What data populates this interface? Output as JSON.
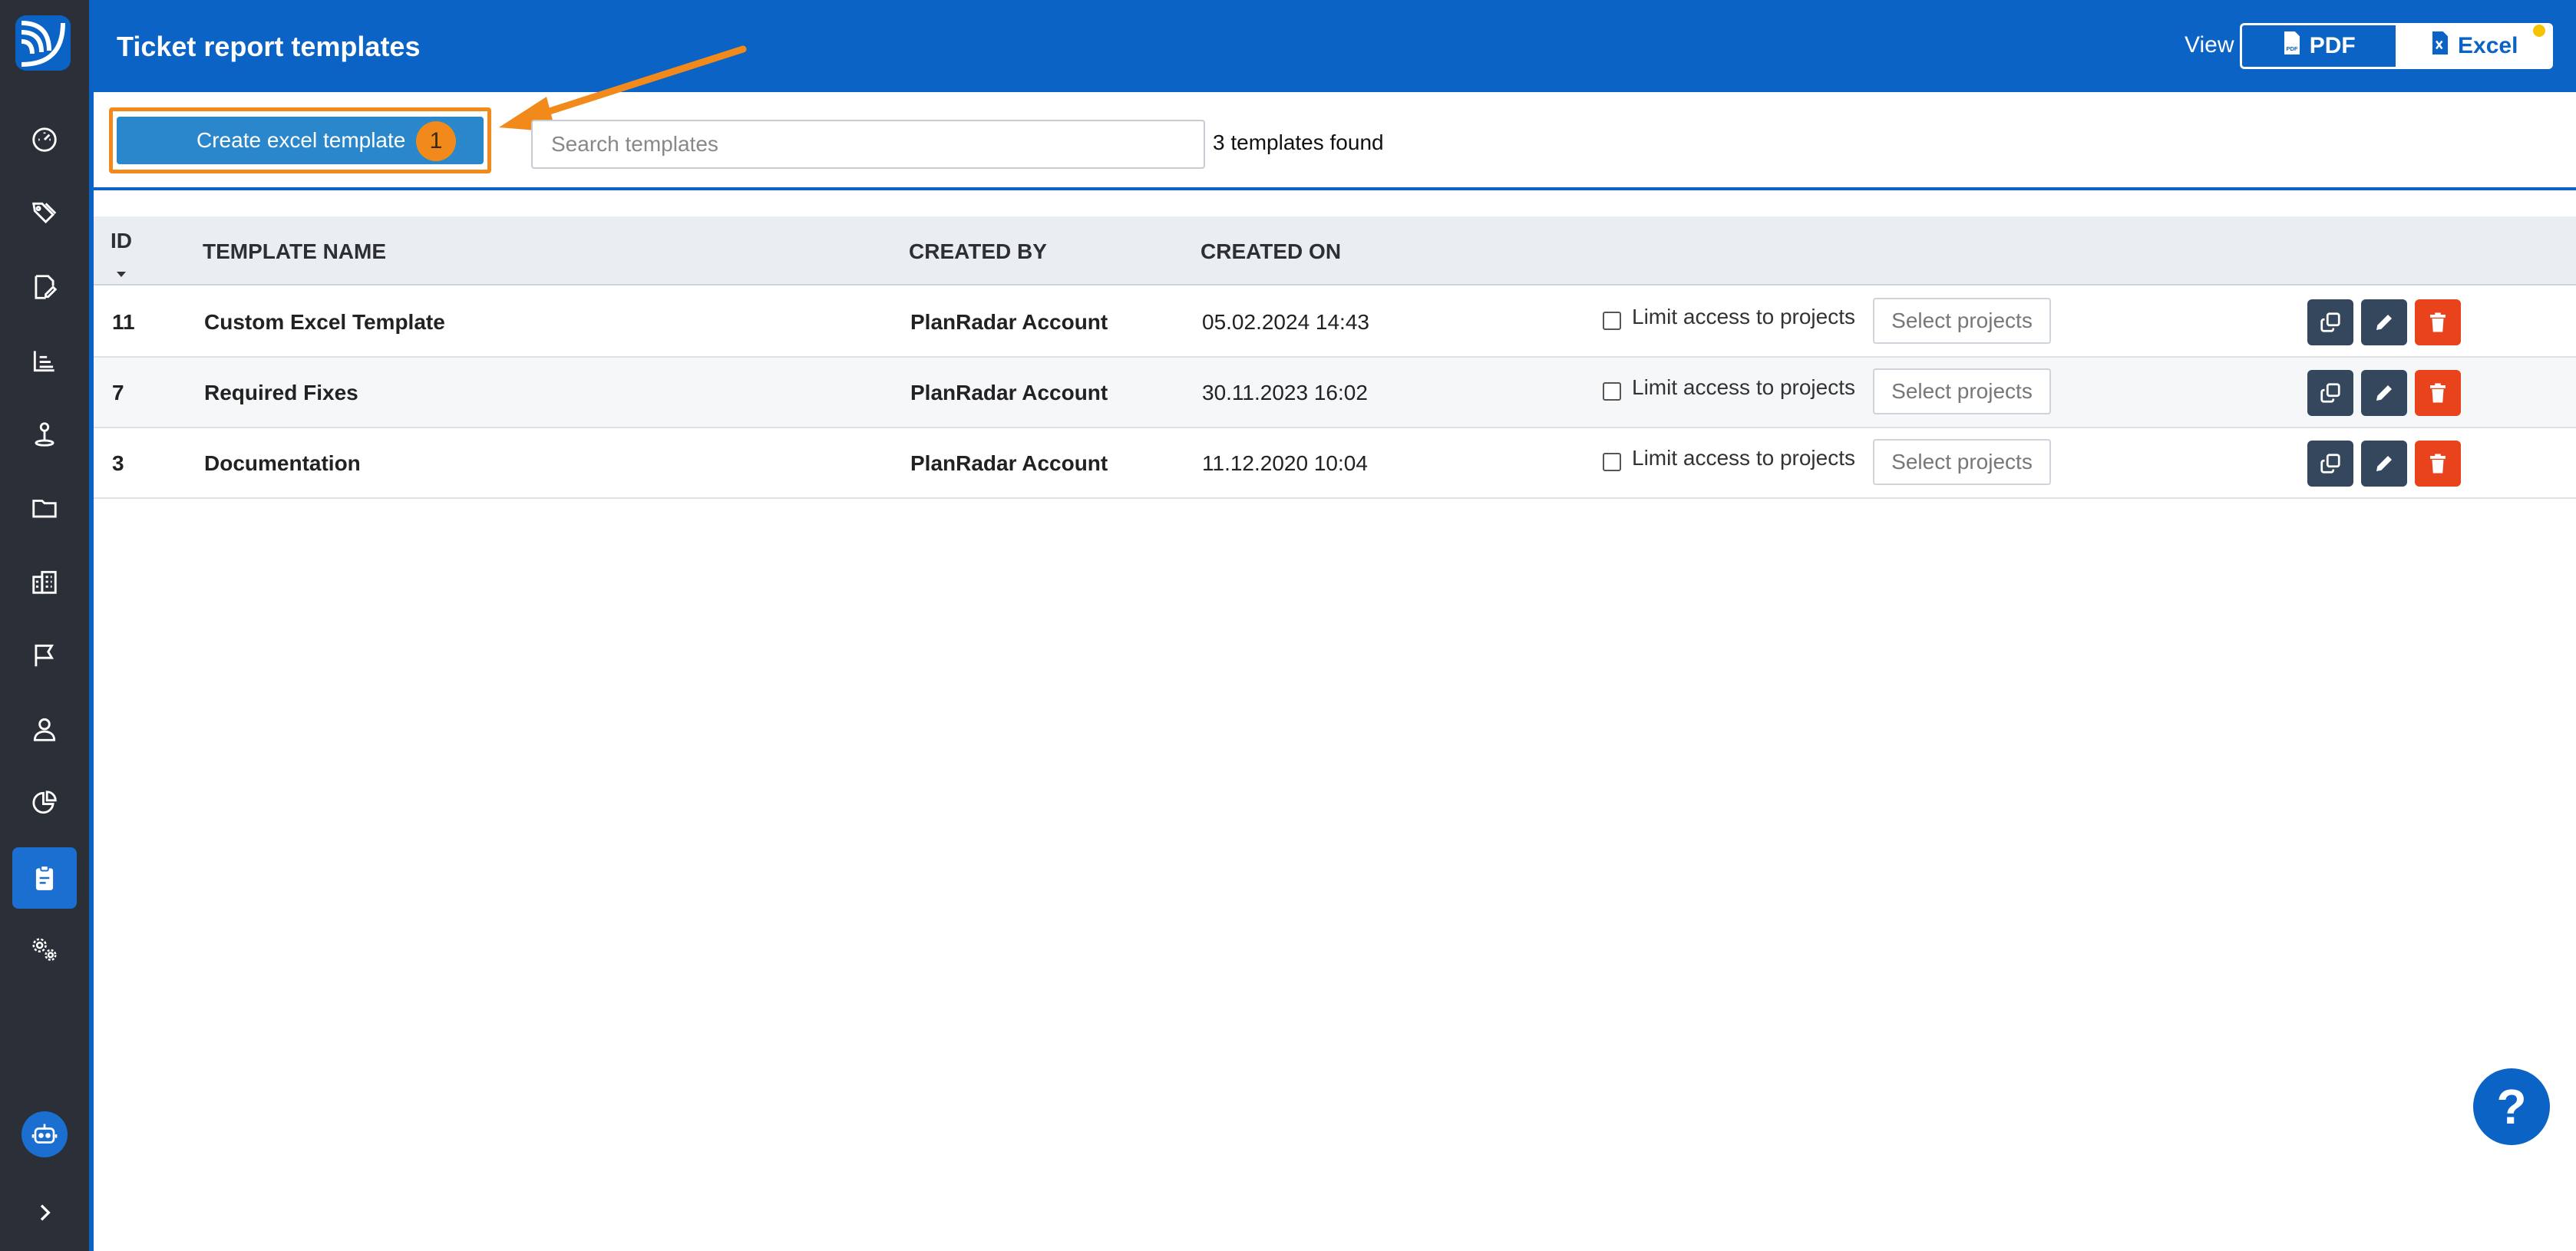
{
  "header": {
    "title": "Ticket report templates",
    "view_label": "View",
    "view_options": [
      "PDF",
      "Excel"
    ],
    "selected_view": "Excel"
  },
  "toolbar": {
    "create_label": "Create excel template",
    "step_badge": "1",
    "search_placeholder": "Search templates",
    "count_text": "3 templates found"
  },
  "table": {
    "columns": [
      "ID",
      "TEMPLATE NAME",
      "CREATED BY",
      "CREATED ON"
    ],
    "rows": [
      {
        "id": "11",
        "name": "Custom Excel Template",
        "created_by": "PlanRadar Account",
        "created_on": "05.02.2024 14:43",
        "limit_label": "Limit access to projects",
        "select_label": "Select projects"
      },
      {
        "id": "7",
        "name": "Required Fixes",
        "created_by": "PlanRadar Account",
        "created_on": "30.11.2023 16:02",
        "limit_label": "Limit access to projects",
        "select_label": "Select projects"
      },
      {
        "id": "3",
        "name": "Documentation",
        "created_by": "PlanRadar Account",
        "created_on": "11.12.2020 10:04",
        "limit_label": "Limit access to projects",
        "select_label": "Select projects"
      }
    ]
  },
  "help": {
    "label": "?"
  },
  "sidebar": {
    "icons": [
      "dashboard-icon",
      "tags-icon",
      "ticket-edit-icon",
      "chart-list-icon",
      "location-pin-icon",
      "folder-icon",
      "building-icon",
      "flag-icon",
      "user-icon",
      "pie-chart-icon",
      "clipboard-icon",
      "settings-icon",
      "bot-icon",
      "chevron-right-icon"
    ],
    "active": "clipboard-icon"
  },
  "colors": {
    "brand_blue": "#0b63c6",
    "button_blue": "#2a87cc",
    "highlight_orange": "#f28a1b",
    "delete_red": "#e8431d",
    "action_dark": "#34475c",
    "sidebar_bg": "#2b2f38"
  }
}
